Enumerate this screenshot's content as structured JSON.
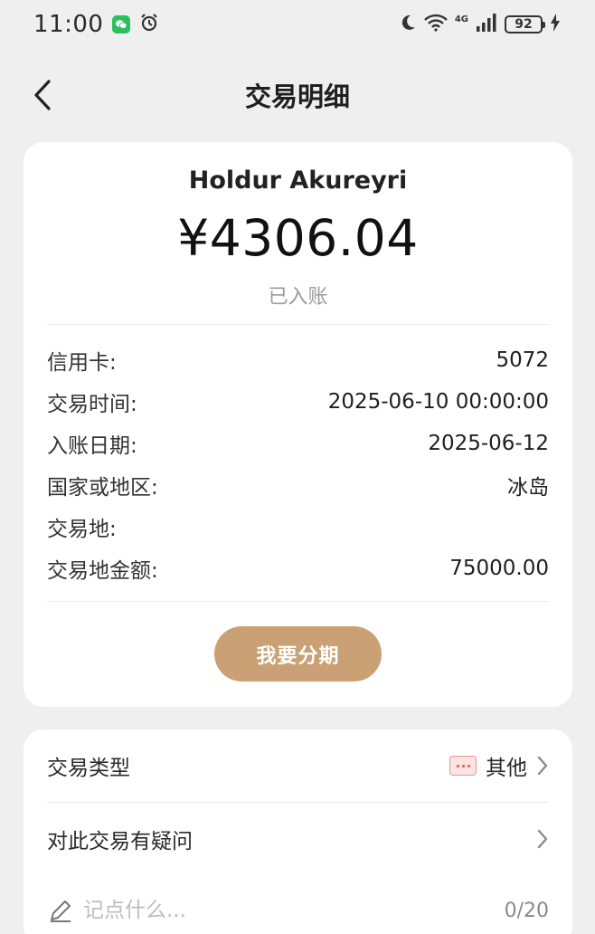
{
  "status_bar": {
    "time": "11:00",
    "network": "4G",
    "battery": "92"
  },
  "header": {
    "title": "交易明细"
  },
  "transaction": {
    "merchant": "Holdur Akureyri",
    "amount": "¥4306.04",
    "status": "已入账",
    "details": [
      {
        "label": "信用卡:",
        "value": "5072"
      },
      {
        "label": "交易时间:",
        "value": "2025-06-10 00:00:00"
      },
      {
        "label": "入账日期:",
        "value": "2025-06-12"
      },
      {
        "label": "国家或地区:",
        "value": "冰岛"
      },
      {
        "label": "交易地:",
        "value": ""
      },
      {
        "label": "交易地金额:",
        "value": "75000.00"
      }
    ],
    "installment_button": "我要分期"
  },
  "extra": {
    "type_label": "交易类型",
    "type_value": "其他",
    "question_label": "对此交易有疑问",
    "note_placeholder": "记点什么...",
    "note_count": "0/20"
  },
  "colors": {
    "accent_button": "#c9a174",
    "background": "#efefef",
    "card": "#ffffff"
  }
}
